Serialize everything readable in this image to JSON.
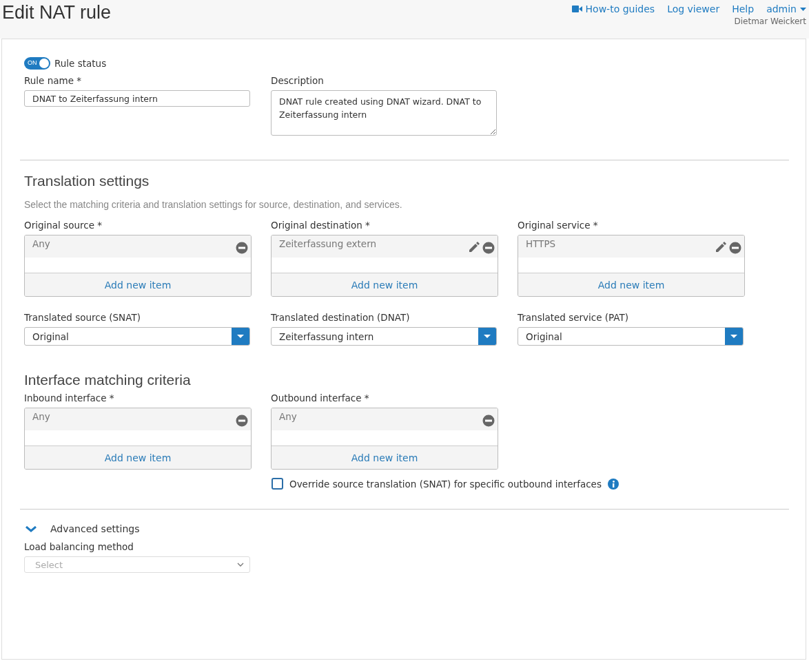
{
  "header": {
    "title": "Edit NAT rule",
    "links": [
      {
        "label": "How-to guides",
        "kind": "video"
      },
      {
        "label": "Log viewer",
        "kind": "text"
      },
      {
        "label": "Help",
        "kind": "text"
      }
    ],
    "user_menu": {
      "label": "admin"
    },
    "user_name": "Dietmar Weickert"
  },
  "rule_status": {
    "label": "Rule status",
    "toggle_text": "ON",
    "on": true
  },
  "rule_name": {
    "label": "Rule name *",
    "value": "DNAT to Zeiterfassung intern"
  },
  "description": {
    "label": "Description",
    "value": "DNAT rule created using DNAT wizard. DNAT to Zeiterfassung intern"
  },
  "translation_settings": {
    "title": "Translation settings",
    "subtitle": "Select the matching criteria and translation settings for source, destination, and services.",
    "original": [
      {
        "label": "Original source *",
        "items": [
          {
            "text": "Any",
            "editable": false
          }
        ],
        "add_label": "Add new item"
      },
      {
        "label": "Original destination *",
        "items": [
          {
            "text": "Zeiterfassung extern",
            "editable": true
          }
        ],
        "add_label": "Add new item"
      },
      {
        "label": "Original service *",
        "items": [
          {
            "text": "HTTPS",
            "editable": true
          }
        ],
        "add_label": "Add new item"
      }
    ],
    "translated": [
      {
        "label": "Translated source (SNAT)",
        "value": "Original"
      },
      {
        "label": "Translated destination (DNAT)",
        "value": "Zeiterfassung intern"
      },
      {
        "label": "Translated service (PAT)",
        "value": "Original"
      }
    ]
  },
  "interface_matching": {
    "title": "Interface matching criteria",
    "lists": [
      {
        "label": "Inbound interface *",
        "items": [
          {
            "text": "Any",
            "editable": false
          }
        ],
        "add_label": "Add new item"
      },
      {
        "label": "Outbound interface *",
        "items": [
          {
            "text": "Any",
            "editable": false
          }
        ],
        "add_label": "Add new item"
      }
    ],
    "override": {
      "label": "Override source translation (SNAT) for specific outbound interfaces",
      "checked": false
    }
  },
  "advanced_settings": {
    "label": "Advanced settings",
    "expanded": true,
    "load_balancing": {
      "label": "Load balancing method",
      "placeholder": "Select"
    }
  }
}
